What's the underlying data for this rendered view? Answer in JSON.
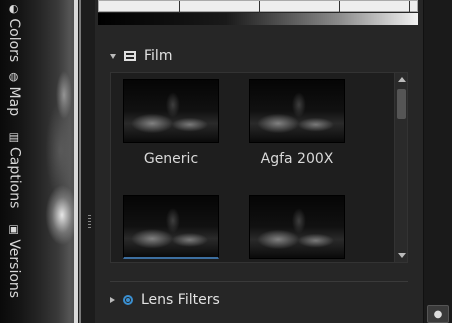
{
  "film_section": {
    "title": "Film",
    "presets": [
      {
        "label": "Generic"
      },
      {
        "label": "Agfa 200X"
      },
      {
        "label": ""
      },
      {
        "label": ""
      }
    ]
  },
  "lens_section": {
    "title": "Lens Filters"
  },
  "side_tabs": [
    {
      "label": "Colors",
      "icon": "colors-icon"
    },
    {
      "label": "Map",
      "icon": "globe-icon"
    },
    {
      "label": "Captions",
      "icon": "captions-icon"
    },
    {
      "label": "Versions",
      "icon": "versions-icon"
    }
  ],
  "colors": {
    "accent": "#3a8fd0",
    "panel_bg": "#262626",
    "tab_bg": "#1a1a1a"
  }
}
